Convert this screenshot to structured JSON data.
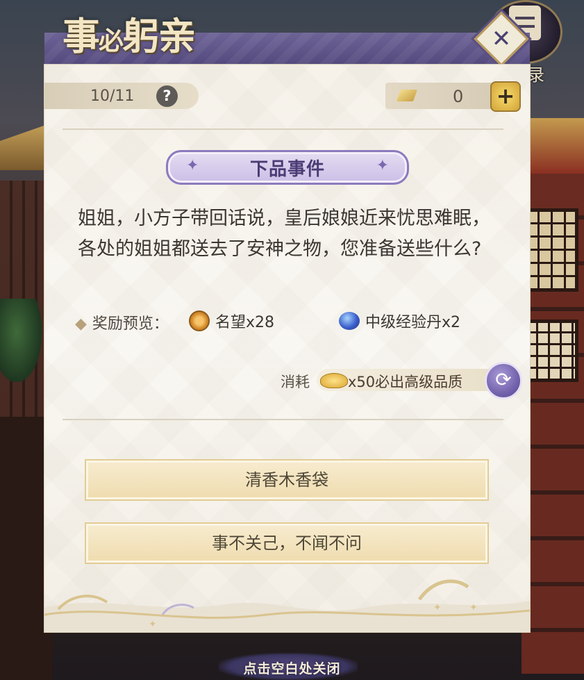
{
  "title": {
    "main": "事",
    "small": "必",
    "rest": "躬亲"
  },
  "top_right": {
    "scroll_label": "录"
  },
  "header": {
    "progress": "10/11",
    "help_symbol": "?",
    "token_count": "0",
    "add_symbol": "+"
  },
  "event": {
    "grade": "下品事件",
    "story": "姐姐，小方子带回话说，皇后娘娘近来忧思难眠，各处的姐姐都送去了安神之物，您准备送些什么?"
  },
  "rewards": {
    "label": "奖励预览：",
    "items": [
      {
        "name": "名望x28",
        "icon": "coin-icon"
      },
      {
        "name": "中级经验丹x2",
        "icon": "orb-icon"
      }
    ]
  },
  "cost": {
    "label": "消耗",
    "text": "x50必出高级品质"
  },
  "choices": [
    {
      "label": "清香木香袋"
    },
    {
      "label": "事不关己，不闻不问"
    }
  ],
  "footer": {
    "close_hint": "点击空白处关闭"
  },
  "colors": {
    "header_purple": "#5f5589",
    "panel_bg": "#f7f4ee",
    "choice_gold": "#efdcae",
    "banner_purple": "#cbbfe6"
  }
}
